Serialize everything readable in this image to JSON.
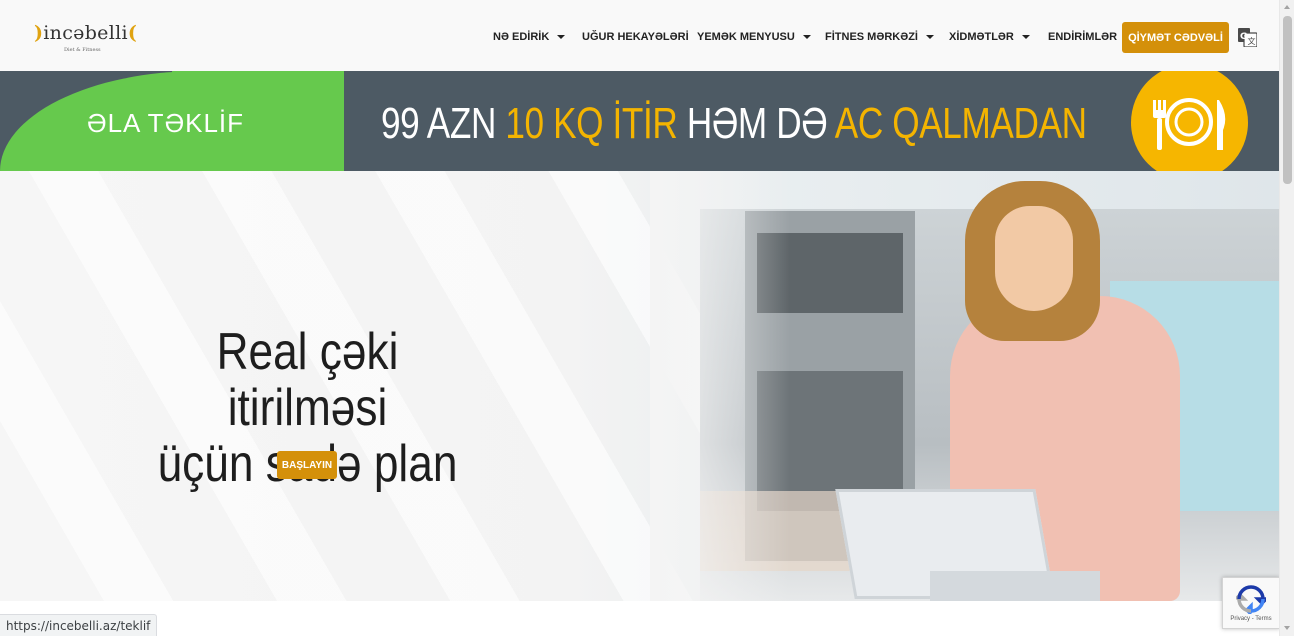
{
  "header": {
    "logo_text": "incəbelli",
    "logo_tagline": "Diet & Fitness",
    "nav": [
      {
        "label": "NƏ EDİRİK",
        "dropdown": true
      },
      {
        "label": "UĞUR HEKAYƏLƏRİ",
        "dropdown": false
      },
      {
        "label": "YEMƏK MENYUSU",
        "dropdown": true
      },
      {
        "label": "FİTNES MƏRKƏZİ",
        "dropdown": true
      },
      {
        "label": "XİDMƏTLƏR",
        "dropdown": true
      },
      {
        "label": "ENDİRİMLƏR",
        "dropdown": false
      }
    ],
    "cta_label": "QİYMƏT CƏDVƏLİ",
    "translate_icon": "google-translate-icon"
  },
  "banner": {
    "offer_label": "ƏLA TƏKLİF",
    "headline_parts": [
      "99 AZN ",
      "10 KQ İTİR",
      " HƏM DƏ ",
      "AC QALMADAN"
    ],
    "icon": "plate-fork-knife-icon"
  },
  "hero": {
    "title_line1": "Real çəki itirilməsi",
    "title_line2": "üçün sadə plan",
    "button_label": "BAŞLAYIN"
  },
  "status_bar": {
    "url": "https://incebelli.az/teklif"
  },
  "recaptcha": {
    "footer_text": "Privacy - Terms"
  },
  "colors": {
    "accent": "#d4900a",
    "banner_bg": "#4d5a64",
    "banner_green": "#66c94d",
    "banner_yellow": "#f4b400"
  }
}
